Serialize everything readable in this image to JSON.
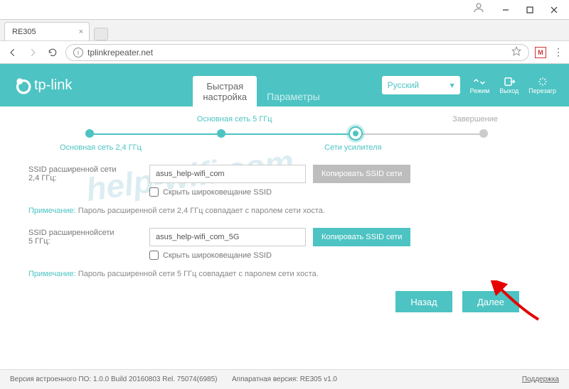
{
  "window": {
    "user_icon": "user"
  },
  "browser": {
    "tab_title": "RE305",
    "url": "tplinkrepeater.net"
  },
  "brand": "tp-link",
  "tabs": {
    "quick_l1": "Быстрая",
    "quick_l2": "настройка",
    "params": "Параметры"
  },
  "lang": {
    "value": "Русский"
  },
  "tools": {
    "mode": "Режим",
    "logout": "Выход",
    "reboot": "Перезагр"
  },
  "wizard": {
    "s1": "Основная сеть 2,4 ГГц",
    "s2": "Основная сеть 5 ГГц",
    "s3": "Сети усилителя",
    "s4": "Завершение"
  },
  "form24": {
    "label_l1": "SSID расширенной сети",
    "label_l2": "2,4 ГГц:",
    "value": "asus_help-wifi_com",
    "copy": "Копировать SSID сети",
    "hide": "Скрыть широковещание SSID"
  },
  "note24": {
    "k": "Примечание:",
    "v": "Пароль расширенной сети 2,4 ГГц совпадает с паролем сети хоста."
  },
  "form5": {
    "label_l1": "SSID расширеннойсети",
    "label_l2": "5 ГГц:",
    "value": "asus_help-wifi_com_5G",
    "copy": "Копировать SSID сети",
    "hide": "Скрыть широковещание SSID"
  },
  "note5": {
    "k": "Примечание:",
    "v": "Пароль расширенной сети 5 ГГц совпадает с паролем сети хоста."
  },
  "nav": {
    "back": "Назад",
    "next": "Далее"
  },
  "footer": {
    "fw": "Версия встроенного ПО: 1.0.0 Build 20160803 Rel. 75074(6985)",
    "hw": "Аппаратная версия: RE305 v1.0",
    "support": "Поддержка"
  },
  "watermark": "help-wifi.com"
}
